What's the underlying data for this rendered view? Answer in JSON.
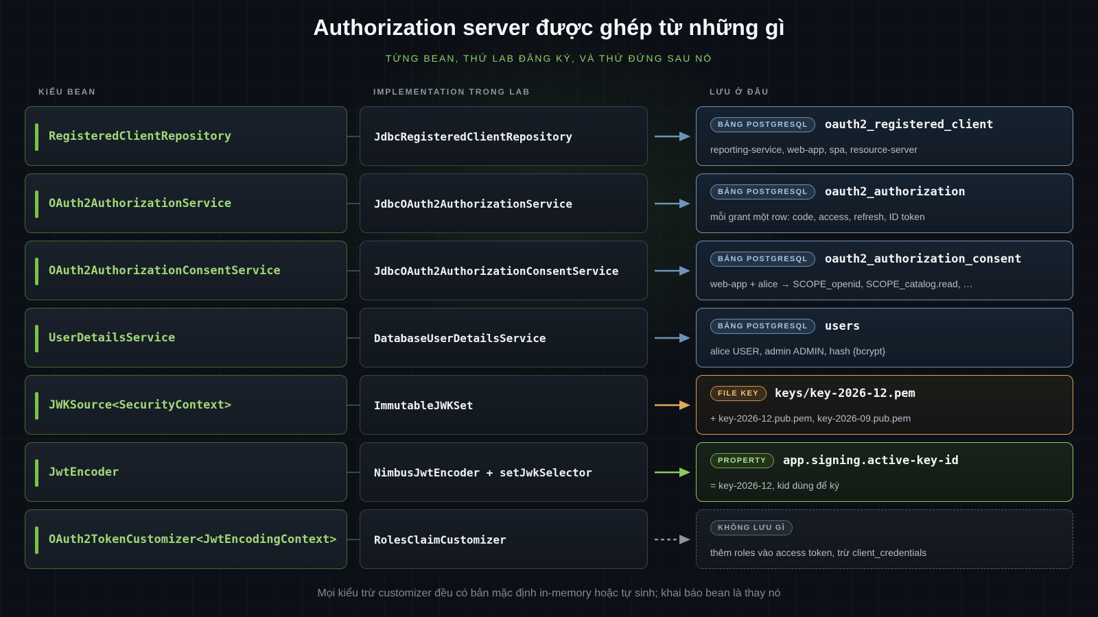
{
  "title": "Authorization server được ghép từ những gì",
  "subtitle": "TỪNG BEAN, THỨ LAB ĐĂNG KÝ, VÀ THỨ ĐỨNG SAU NÓ",
  "columns": {
    "bean": "KIỂU BEAN",
    "impl": "IMPLEMENTATION TRONG LAB",
    "storage": "LƯU Ở ĐÂU"
  },
  "colors": {
    "bean_accent": "#7cc24d",
    "postgres": "#6e93b8",
    "file": "#d6a05a",
    "property": "#8cc95e",
    "none": "#55606e"
  },
  "rows": [
    {
      "bean": "RegisteredClientRepository",
      "impl": "JdbcRegisteredClientRepository",
      "badge": "BẢNG POSTGRESQL",
      "name": "oauth2_registered_client",
      "desc": "reporting-service, web-app, spa, resource-server"
    },
    {
      "bean": "OAuth2AuthorizationService",
      "impl": "JdbcOAuth2AuthorizationService",
      "badge": "BẢNG POSTGRESQL",
      "name": "oauth2_authorization",
      "desc": "mỗi grant một row: code, access, refresh, ID token"
    },
    {
      "bean": "OAuth2AuthorizationConsentService",
      "impl": "JdbcOAuth2AuthorizationConsentService",
      "badge": "BẢNG POSTGRESQL",
      "name": "oauth2_authorization_consent",
      "desc": "web-app + alice → SCOPE_openid, SCOPE_catalog.read, …"
    },
    {
      "bean": "UserDetailsService",
      "impl": "DatabaseUserDetailsService",
      "badge": "BẢNG POSTGRESQL",
      "name": "users",
      "desc": "alice USER, admin ADMIN, hash {bcrypt}"
    },
    {
      "bean": "JWKSource<SecurityContext>",
      "impl": "ImmutableJWKSet",
      "badge": "FILE KEY",
      "name": "keys/key-2026-12.pem",
      "desc": "+ key-2026-12.pub.pem, key-2026-09.pub.pem"
    },
    {
      "bean": "JwtEncoder",
      "impl": "NimbusJwtEncoder + setJwkSelector",
      "badge": "PROPERTY",
      "name": "app.signing.active-key-id",
      "desc": "= key-2026-12, kid dùng để ký"
    },
    {
      "bean": "OAuth2TokenCustomizer<JwtEncodingContext>",
      "impl": "RolesClaimCustomizer",
      "badge": "KHÔNG LƯU GÌ",
      "name": "",
      "desc": "thêm roles vào access token, trừ client_credentials"
    }
  ],
  "footer": "Mọi kiểu trừ customizer đều có bản mặc định in-memory hoặc tự sinh; khai báo bean là thay nó"
}
